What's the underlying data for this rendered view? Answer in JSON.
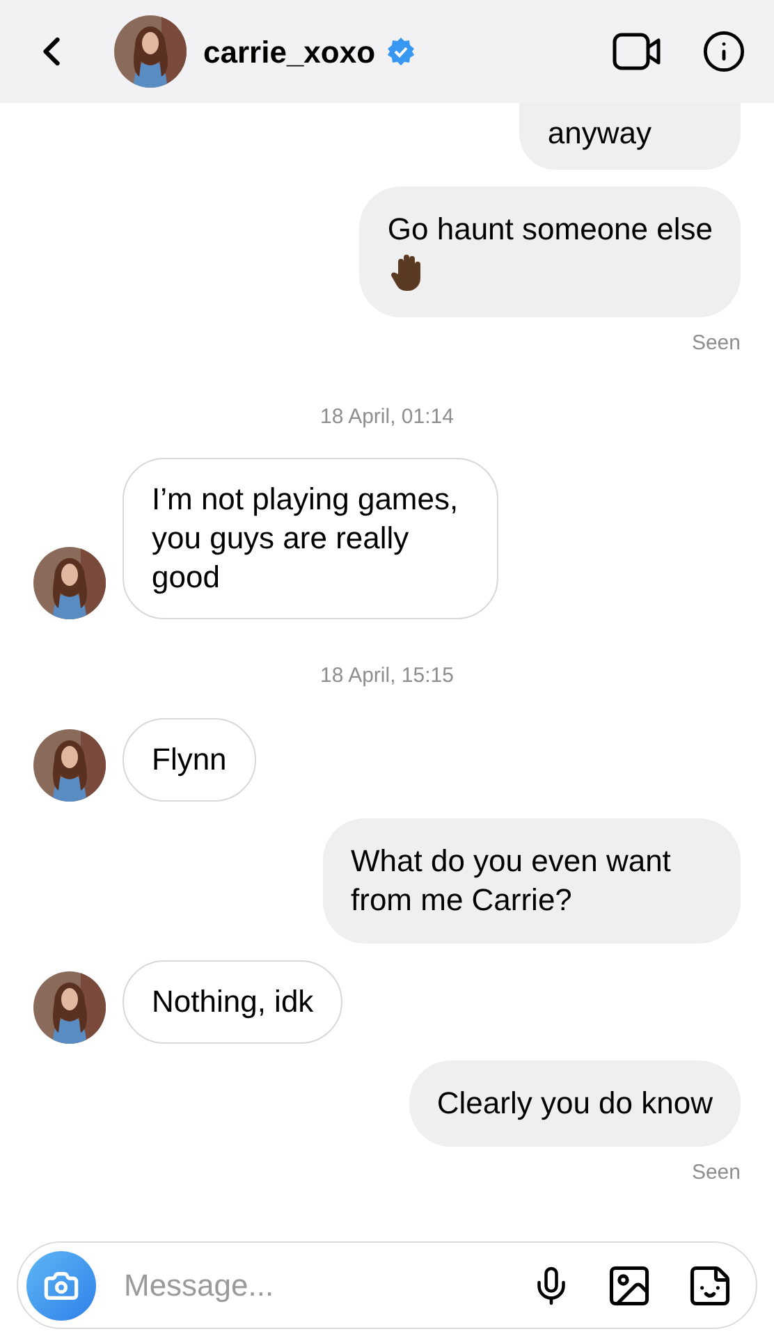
{
  "header": {
    "username": "carrie_xoxo",
    "verified": true
  },
  "messages": [
    {
      "kind": "outgoing",
      "text": "anyway",
      "cut": true
    },
    {
      "kind": "outgoing",
      "text": "Go haunt someone else",
      "emoji": true
    },
    {
      "kind": "seen",
      "text": "Seen"
    },
    {
      "kind": "timestamp",
      "text": "18 April, 01:14"
    },
    {
      "kind": "incoming",
      "text": "I’m not playing games, you guys are really good"
    },
    {
      "kind": "timestamp",
      "text": "18 April, 15:15"
    },
    {
      "kind": "incoming",
      "text": "Flynn"
    },
    {
      "kind": "outgoing",
      "text": "What do you even want from me Carrie?"
    },
    {
      "kind": "incoming",
      "text": "Nothing, idk"
    },
    {
      "kind": "outgoing",
      "text": "Clearly you do know"
    },
    {
      "kind": "seen",
      "text": "Seen"
    }
  ],
  "composer": {
    "placeholder": "Message..."
  }
}
